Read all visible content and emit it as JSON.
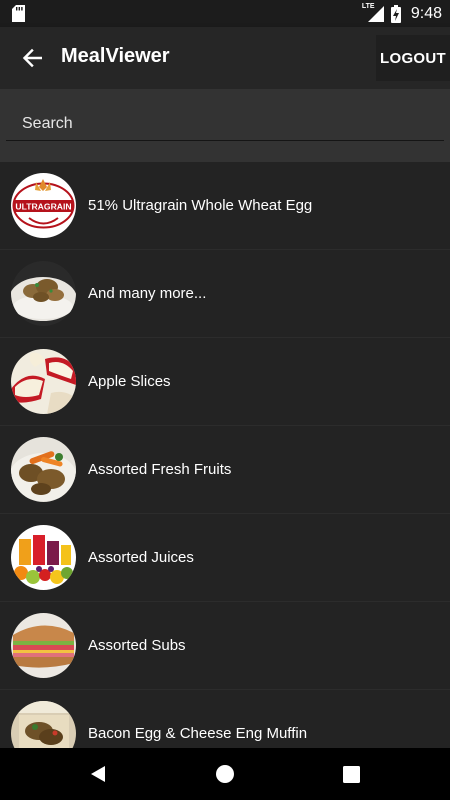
{
  "status_bar": {
    "network_label": "LTE",
    "time": "9:48"
  },
  "app_bar": {
    "title": "MealViewer",
    "logout_label": "LOGOUT"
  },
  "search": {
    "placeholder": "Search",
    "value": ""
  },
  "meals": [
    {
      "name": "51% Ultragrain Whole Wheat Egg",
      "image": "ultragrain-logo",
      "logo_text": "ULTRAGRAIN"
    },
    {
      "name": "And many more...",
      "image": "meat-rice-plate"
    },
    {
      "name": "Apple Slices",
      "image": "apple-slices"
    },
    {
      "name": "Assorted Fresh Fruits",
      "image": "meat-carrot-plate"
    },
    {
      "name": "Assorted Juices",
      "image": "juices-fruits"
    },
    {
      "name": "Assorted Subs",
      "image": "sub-sandwich"
    },
    {
      "name": "Bacon Egg & Cheese Eng Muffin",
      "image": "muffin-box"
    }
  ],
  "colors": {
    "background": "#222222",
    "app_bar": "#262626",
    "search_bg": "#333333",
    "text": "#ffffff"
  }
}
